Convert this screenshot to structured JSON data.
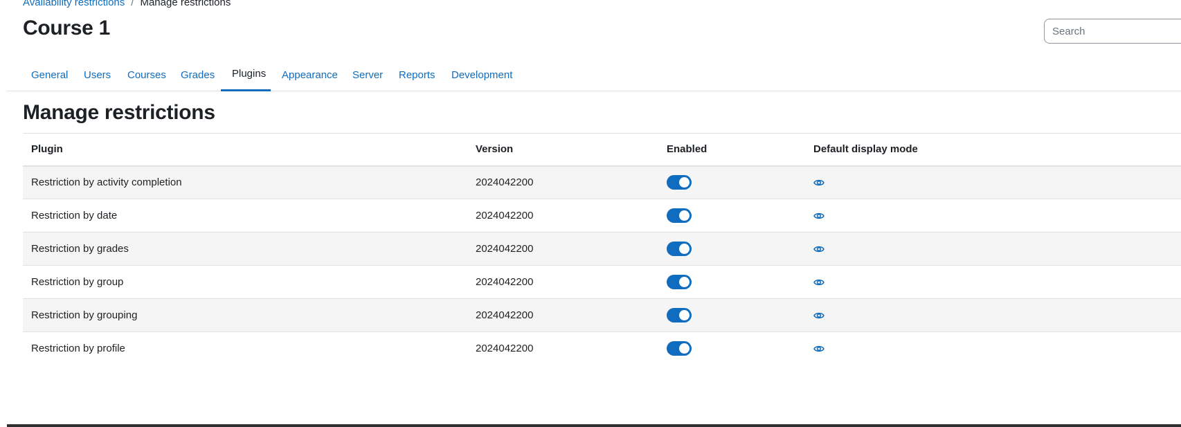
{
  "breadcrumb": {
    "parent": "Availability restrictions",
    "separator": "/",
    "current": "Manage restrictions"
  },
  "page_title": "Course 1",
  "search": {
    "placeholder": "Search",
    "value": ""
  },
  "nav": {
    "tabs": [
      {
        "label": "General"
      },
      {
        "label": "Users"
      },
      {
        "label": "Courses"
      },
      {
        "label": "Grades"
      },
      {
        "label": "Plugins",
        "active": true
      },
      {
        "label": "Appearance"
      },
      {
        "label": "Server"
      },
      {
        "label": "Reports"
      },
      {
        "label": "Development"
      }
    ]
  },
  "section_title": "Manage restrictions",
  "table": {
    "headers": {
      "plugin": "Plugin",
      "version": "Version",
      "enabled": "Enabled",
      "display_mode": "Default display mode"
    },
    "rows": [
      {
        "plugin": "Restriction by activity completion",
        "version": "2024042200",
        "enabled": true,
        "display_icon": "eye-icon"
      },
      {
        "plugin": "Restriction by date",
        "version": "2024042200",
        "enabled": true,
        "display_icon": "eye-icon"
      },
      {
        "plugin": "Restriction by grades",
        "version": "2024042200",
        "enabled": true,
        "display_icon": "eye-icon"
      },
      {
        "plugin": "Restriction by group",
        "version": "2024042200",
        "enabled": true,
        "display_icon": "eye-icon"
      },
      {
        "plugin": "Restriction by grouping",
        "version": "2024042200",
        "enabled": true,
        "display_icon": "eye-icon"
      },
      {
        "plugin": "Restriction by profile",
        "version": "2024042200",
        "enabled": true,
        "display_icon": "eye-icon"
      }
    ]
  },
  "colors": {
    "accent": "#0f6cbf",
    "text": "#1d2125",
    "row_stripe": "#f5f5f5",
    "border": "#dee2e6"
  }
}
